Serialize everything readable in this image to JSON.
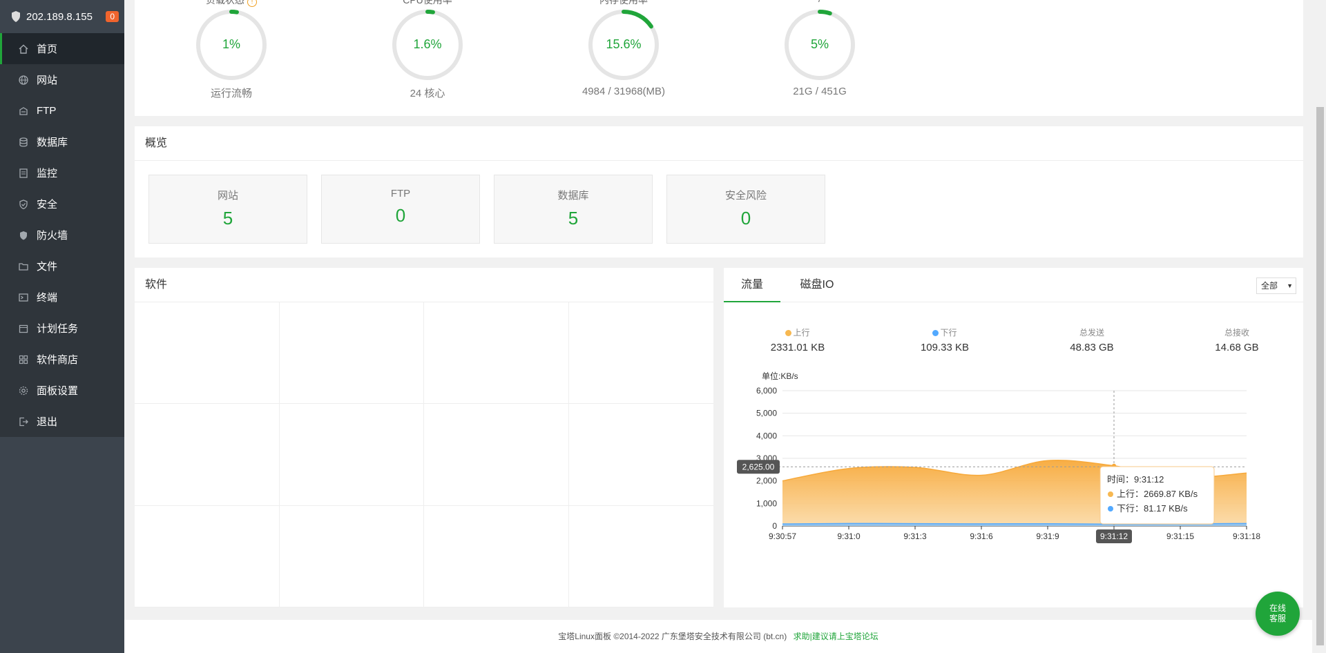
{
  "sidebar": {
    "ip": "202.189.8.155",
    "badge": "0",
    "items": [
      {
        "label": "首页",
        "icon": "home-icon"
      },
      {
        "label": "网站",
        "icon": "globe-icon"
      },
      {
        "label": "FTP",
        "icon": "ftp-icon"
      },
      {
        "label": "数据库",
        "icon": "database-icon"
      },
      {
        "label": "监控",
        "icon": "monitor-icon"
      },
      {
        "label": "安全",
        "icon": "shield-check-icon"
      },
      {
        "label": "防火墙",
        "icon": "firewall-icon"
      },
      {
        "label": "文件",
        "icon": "folder-icon"
      },
      {
        "label": "终端",
        "icon": "terminal-icon"
      },
      {
        "label": "计划任务",
        "icon": "calendar-icon"
      },
      {
        "label": "软件商店",
        "icon": "grid-icon"
      },
      {
        "label": "面板设置",
        "icon": "settings-icon"
      },
      {
        "label": "退出",
        "icon": "logout-icon"
      }
    ]
  },
  "status": {
    "gauges": [
      {
        "title": "负载状态",
        "value": "1%",
        "percent": 1,
        "sub": "运行流畅"
      },
      {
        "title": "CPU使用率",
        "value": "1.6%",
        "percent": 1.6,
        "sub": "24 核心"
      },
      {
        "title": "内存使用率",
        "value": "15.6%",
        "percent": 15.6,
        "sub": "4984 / 31968(MB)"
      },
      {
        "title": "/",
        "value": "5%",
        "percent": 5,
        "sub": "21G / 451G"
      }
    ]
  },
  "overview": {
    "title": "概览",
    "boxes": [
      {
        "label": "网站",
        "value": "5"
      },
      {
        "label": "FTP",
        "value": "0"
      },
      {
        "label": "数据库",
        "value": "5"
      },
      {
        "label": "安全风险",
        "value": "0"
      }
    ]
  },
  "software": {
    "title": "软件"
  },
  "traffic": {
    "tabs": [
      "流量",
      "磁盘IO"
    ],
    "select_value": "全部",
    "stats": [
      {
        "label": "上行",
        "value": "2331.01 KB",
        "dot": "#f7b851"
      },
      {
        "label": "下行",
        "value": "109.33 KB",
        "dot": "#52a9ff"
      },
      {
        "label": "总发送",
        "value": "48.83 GB"
      },
      {
        "label": "总接收",
        "value": "14.68 GB"
      }
    ]
  },
  "chart_data": {
    "type": "area",
    "ylabel": "单位:KB/s",
    "ylim": [
      0,
      6000
    ],
    "yticks": [
      "0",
      "1,000",
      "2,000",
      "3,000",
      "4,000",
      "5,000",
      "6,000"
    ],
    "x": [
      "9:30:57",
      "9:31:0",
      "9:31:3",
      "9:31:6",
      "9:31:9",
      "9:31:12",
      "9:31:15",
      "9:31:18"
    ],
    "series": [
      {
        "name": "上行",
        "color": "#f7b851",
        "values": [
          2000,
          2550,
          2600,
          2250,
          2900,
          2670,
          2150,
          2350
        ]
      },
      {
        "name": "下行",
        "color": "#52a9ff",
        "values": [
          90,
          110,
          105,
          95,
          100,
          81,
          95,
          110
        ]
      }
    ],
    "crosshair_value": "2,625.00",
    "crosshair_x": "9:31:12",
    "tooltip": {
      "time_label": "时间：",
      "time": "9:31:12",
      "up_label": "上行：",
      "up": "2669.87 KB/s",
      "down_label": "下行：",
      "down": "81.17 KB/s"
    }
  },
  "footer": {
    "copyright": "宝塔Linux面板 ©2014-2022 广东堡塔安全技术有限公司 (bt.cn)",
    "link": "求助|建议请上宝塔论坛"
  },
  "kefu": {
    "line1": "在线",
    "line2": "客服"
  },
  "colors": {
    "accent": "#20a53a",
    "sidebar": "#3c444d",
    "up": "#f7b851",
    "down": "#52a9ff"
  }
}
